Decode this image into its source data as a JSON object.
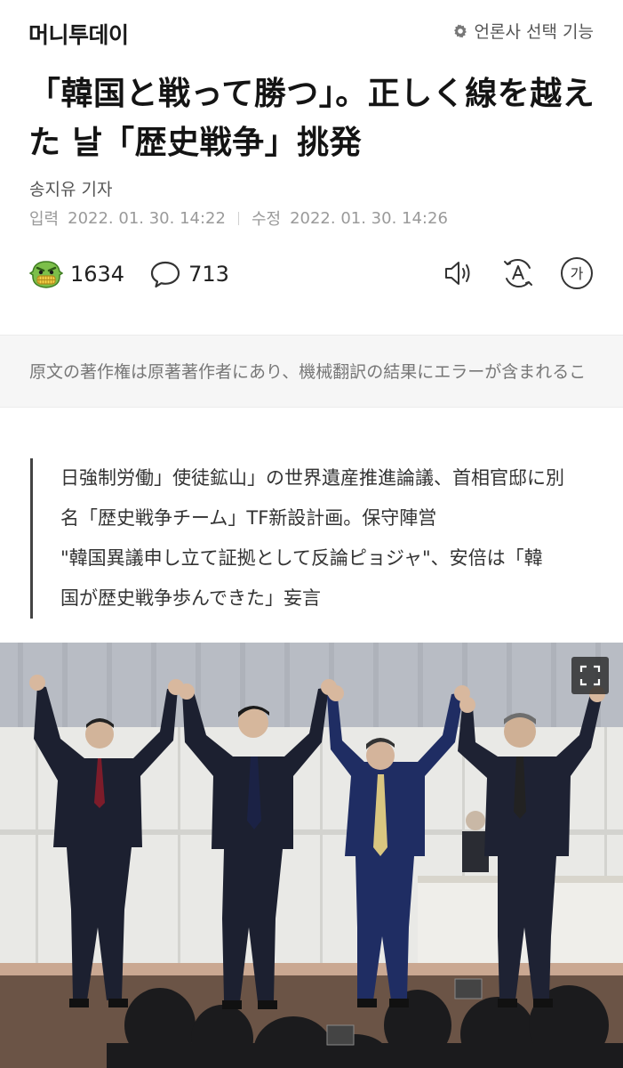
{
  "header": {
    "press_name": "머니투데이",
    "press_select_label": "언론사 선택 기능"
  },
  "article": {
    "headline_line1": "「韓国と戦って勝つ」。正しく線を越え",
    "headline_line2": "た 날「歴史戦争」挑発",
    "reporter": "송지유 기자",
    "published_label": "입력",
    "published_at": "2022. 01. 30. 14:22",
    "modified_label": "수정",
    "modified_at": "2022. 01. 30. 14:26"
  },
  "reactions": {
    "reaction_count": "1634",
    "comment_count": "713",
    "reaction_icon": "angry-face-icon",
    "comment_icon": "speech-bubble-icon",
    "tools": [
      "speaker-icon",
      "text-size-icon",
      "translate-icon"
    ],
    "translate_glyph": "가"
  },
  "notice": {
    "text": "原文の著作権は原著著作者にあり、機械翻訳の結果にエラーが含まれるこ"
  },
  "summary": {
    "lines": [
      "日強制労働」使徒鉱山」の世界遺産推進論議、首相官邸に別",
      "名「歴史戦争チーム」TF新設計画。保守陣営",
      "\"韓国異議申し立て証拠として反論ピョジャ\"、安倍は「韓",
      "国が歴史戦争歩んできた」妄言"
    ]
  },
  "photo": {
    "expand_icon": "expand-icon",
    "colors": {
      "backdrop": "#e4e4e2",
      "curtain": "#d9dadb",
      "suit": "#1c2030",
      "suit_blue": "#1f2d63",
      "stage_carpet": "#5c4a3d"
    }
  }
}
